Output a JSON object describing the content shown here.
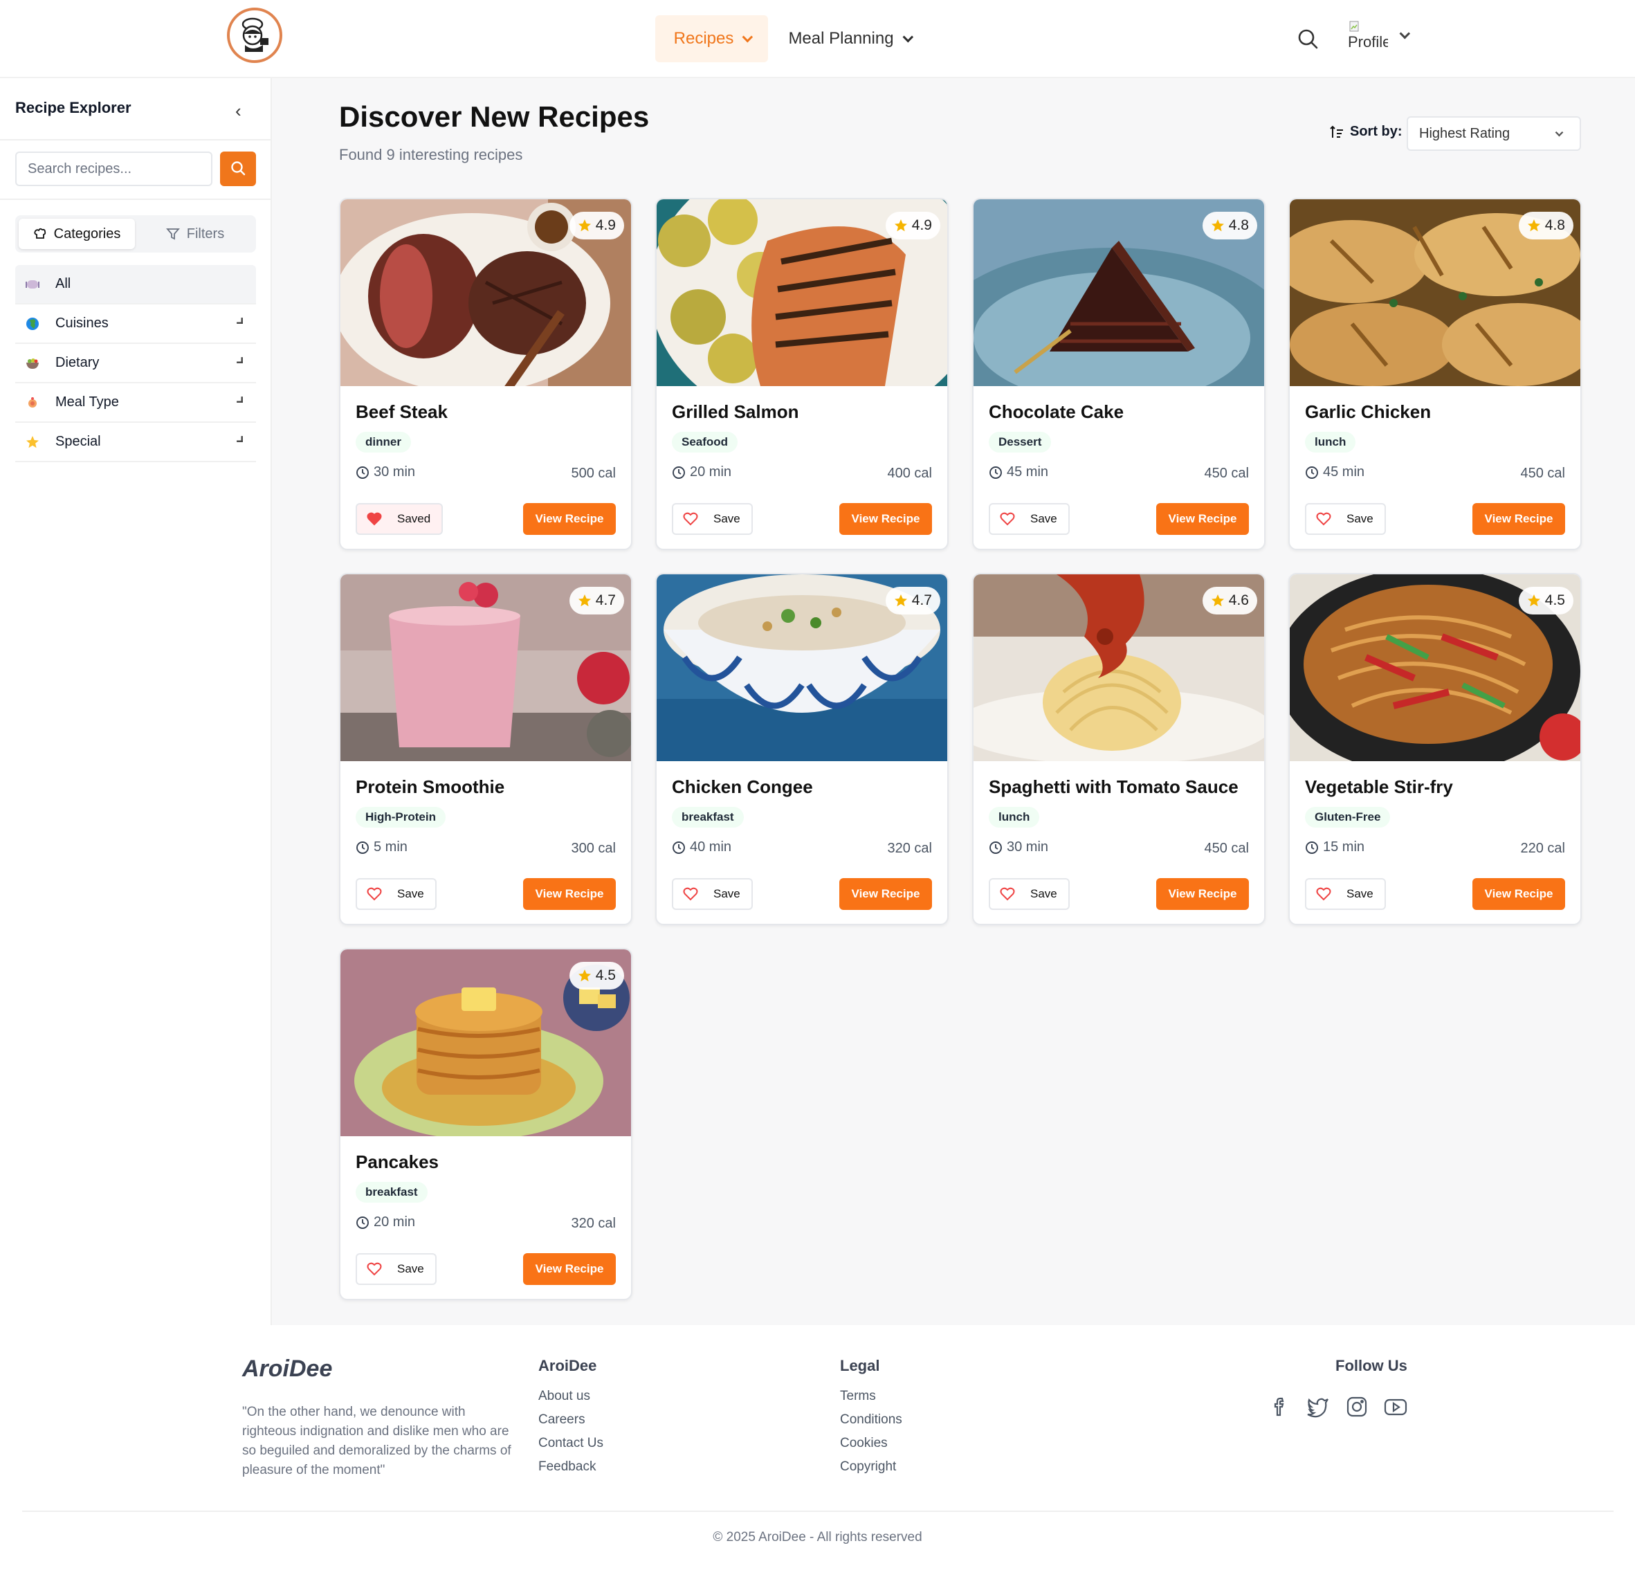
{
  "header": {
    "nav": [
      {
        "label": "Recipes"
      },
      {
        "label": "Meal Planning"
      }
    ],
    "profile_alt": "Profile"
  },
  "sidebar": {
    "title": "Recipe Explorer",
    "search_placeholder": "Search recipes...",
    "tabs": [
      {
        "label": "Categories"
      },
      {
        "label": "Filters"
      }
    ],
    "categories": [
      {
        "label": "All",
        "icon": "plate-icon"
      },
      {
        "label": "Cuisines",
        "icon": "globe-icon"
      },
      {
        "label": "Dietary",
        "icon": "salad-icon"
      },
      {
        "label": "Meal Type",
        "icon": "meal-icon"
      },
      {
        "label": "Special",
        "icon": "star-icon"
      }
    ]
  },
  "main": {
    "title": "Discover New Recipes",
    "subtitle": "Found 9 interesting recipes",
    "sort_label": "Sort by:",
    "sort_value": "Highest Rating"
  },
  "recipes": [
    {
      "title": "Beef Steak",
      "tag": "dinner",
      "rating": "4.9",
      "time": "30 min",
      "calories": "500 cal",
      "save_label": "Saved",
      "view_label": "View Recipe"
    },
    {
      "title": "Grilled Salmon",
      "tag": "Seafood",
      "rating": "4.9",
      "time": "20 min",
      "calories": "400 cal",
      "save_label": "Save",
      "view_label": "View Recipe"
    },
    {
      "title": "Chocolate Cake",
      "tag": "Dessert",
      "rating": "4.8",
      "time": "45 min",
      "calories": "450 cal",
      "save_label": "Save",
      "view_label": "View Recipe"
    },
    {
      "title": "Garlic Chicken",
      "tag": "lunch",
      "rating": "4.8",
      "time": "45 min",
      "calories": "450 cal",
      "save_label": "Save",
      "view_label": "View Recipe"
    },
    {
      "title": "Protein Smoothie",
      "tag": "High-Protein",
      "rating": "4.7",
      "time": "5 min",
      "calories": "300 cal",
      "save_label": "Save",
      "view_label": "View Recipe"
    },
    {
      "title": "Chicken Congee",
      "tag": "breakfast",
      "rating": "4.7",
      "time": "40 min",
      "calories": "320 cal",
      "save_label": "Save",
      "view_label": "View Recipe"
    },
    {
      "title": "Spaghetti with Tomato Sauce",
      "tag": "lunch",
      "rating": "4.6",
      "time": "30 min",
      "calories": "450 cal",
      "save_label": "Save",
      "view_label": "View Recipe"
    },
    {
      "title": "Vegetable Stir-fry",
      "tag": "Gluten-Free",
      "rating": "4.5",
      "time": "15 min",
      "calories": "220 cal",
      "save_label": "Save",
      "view_label": "View Recipe"
    },
    {
      "title": "Pancakes",
      "tag": "breakfast",
      "rating": "4.5",
      "time": "20 min",
      "calories": "320 cal",
      "save_label": "Save",
      "view_label": "View Recipe"
    }
  ],
  "footer": {
    "brand": "AroiDee",
    "quote": "\"On the other hand, we denounce with righteous indignation and dislike men who are so beguiled and demoralized by the charms of pleasure of the moment\"",
    "col1": {
      "title": "AroiDee",
      "links": [
        "About us",
        "Careers",
        "Contact Us",
        "Feedback"
      ]
    },
    "col2": {
      "title": "Legal",
      "links": [
        "Terms",
        "Conditions",
        "Cookies",
        "Copyright"
      ]
    },
    "social_title": "Follow Us",
    "social_icons": [
      "facebook-icon",
      "twitter-icon",
      "instagram-icon",
      "youtube-icon"
    ],
    "copyright": "© 2025 AroiDee - All rights reserved"
  },
  "colors": {
    "accent": "#f97316",
    "accent_soft": "#fff3e8",
    "star": "#f5b400",
    "heart": "#ef4444"
  }
}
